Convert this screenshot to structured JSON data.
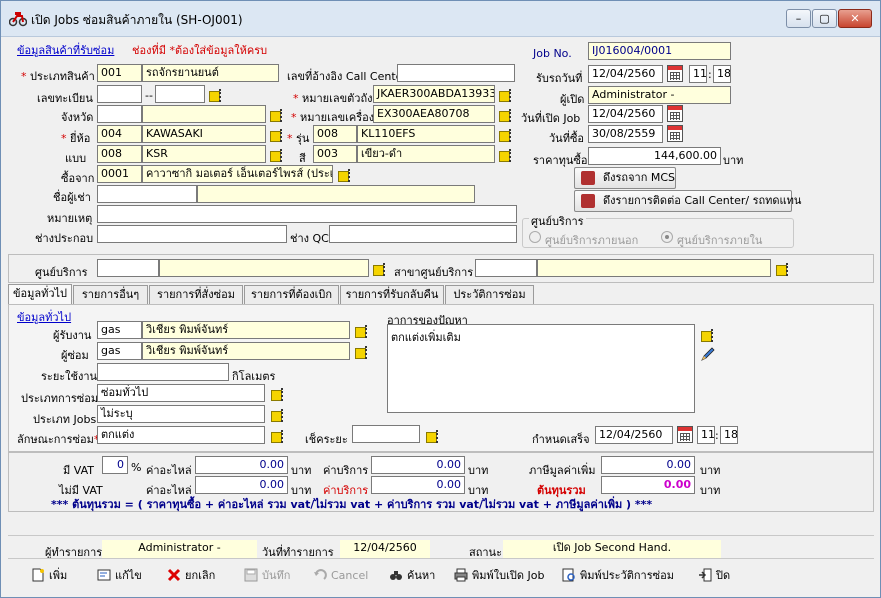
{
  "window": {
    "title": "เปิด Jobs ซ่อมสินค้าภายใน (SH-OJ001)",
    "min_label": "–",
    "max_label": "▢",
    "close_label": "✕"
  },
  "product": {
    "section_link": "ข้อมูลสินค้าที่รับซ่อม",
    "required_note": "ช่องที่มี *ต้องใส่ข้อมูลให้ครบ",
    "type_label": "ประเภทสินค้า",
    "type_code": "001",
    "type_name": "รถจักรยานยนต์",
    "regno_label": "เลขทะเบียน",
    "regno_a": "",
    "regno_sep": "--",
    "regno_b": "",
    "province_label": "จังหวัด",
    "province_code": "",
    "province_name": "",
    "brand_label": "ยี่ห้อ",
    "brand_code": "004",
    "brand_name": "KAWASAKI",
    "model_label": "แบบ",
    "model_code": "008",
    "model_name": "KSR",
    "bought_from_label": "ซื้อจาก",
    "bought_from_code": "0001",
    "bought_from_name": "คาวาซากิ มอเตอร์ เอ็นเตอร์ไพรส์ (ประเท",
    "renter_label": "ชื่อผู้เช่า",
    "renter_a": "",
    "renter_b": "",
    "note_label": "หมายเหตุ",
    "note": "",
    "assembler_label": "ช่างประกอบ",
    "assembler": "",
    "qc_label": "ช่าง QC",
    "qc": "",
    "callcenter_ref_label": "เลขที่อ้างอิง Call Center",
    "callcenter_ref": "",
    "chassis_label": "หมายเลขตัวถัง",
    "chassis": "JKAER300ABDA13933",
    "engine_label": "หมายเลขเครื่อง",
    "engine": "EX300AEA80708",
    "series_label": "รุ่น",
    "series_code": "008",
    "series_name": "KL110EFS",
    "color_label": "สี",
    "color_code": "003",
    "color_name": "เขียว-ดำ"
  },
  "job": {
    "jobno_label": "Job No.",
    "jobno": "IJ016004/0001",
    "received_label": "รับรถวันที่",
    "received_date": "12/04/2560",
    "received_hh": "11",
    "received_mm": "18",
    "opener_label": "ผู้เปิด",
    "opener": "Administrator -",
    "open_date_label": "วันที่เปิด Job",
    "open_date": "12/04/2560",
    "buy_date_label": "วันที่ซื้อ",
    "buy_date": "30/08/2559",
    "cost_label": "ราคาทุนซื้อ",
    "cost": "144,600.00",
    "cost_unit": "บาท",
    "pull_mcs_label": "ดึงรถจาก MCS",
    "pull_callcenter_label": "ดึงรายการติดต่อ Call Center/ รถทดแทน",
    "service_center_group": "ศูนย์บริการ",
    "radio_external": "ศูนย์บริการภายนอก",
    "radio_internal": "ศูนย์บริการภายใน"
  },
  "service": {
    "center_label": "ศูนย์บริการ",
    "center_code": "",
    "center_name": "",
    "branch_label": "สาขาศูนย์บริการ",
    "branch_code": "",
    "branch_name": ""
  },
  "tabs": [
    "ข้อมูลทั่วไป",
    "รายการอื่นๆ",
    "รายการที่สั่งซ่อม",
    "รายการที่ต้องเบิก",
    "รายการที่รับกลับคืน",
    "ประวัติการซ่อม"
  ],
  "general": {
    "section_link": "ข้อมูลทั่วไป",
    "receiver_label": "ผู้รับงาน",
    "receiver_code": "gas",
    "receiver_name": "วิเชียร พิมพ์จันทร์",
    "repairer_label": "ผู้ซ่อม",
    "repairer_code": "gas",
    "repairer_name": "วิเชียร พิมพ์จันทร์",
    "distance_label": "ระยะใช้งาน",
    "distance": "",
    "distance_unit": "กิโลเมตร",
    "repair_type_label": "ประเภทการซ่อม",
    "repair_type": "ซ่อมทั่วไป",
    "job_type_label": "ประเภท Jobs",
    "job_type": "ไม่ระบุ",
    "repair_nature_label": "ลักษณะการซ่อม",
    "repair_nature": "ตกแต่ง",
    "check_interval_label": "เช็คระยะ",
    "check_interval": "",
    "symptom_label": "อาการของปัญหา",
    "symptom": "ตกแต่งเพิ่มเติม",
    "due_label": "กำหนดเสร็จ",
    "due_date": "12/04/2560",
    "due_hh": "11",
    "due_mm": "18"
  },
  "costs": {
    "vat_label": "มี VAT",
    "vat_rate": "0",
    "pct": "%",
    "parts_label": "ค่าอะไหล่",
    "parts_vat": "0.00",
    "baht": "บาท",
    "service_label": "ค่าบริการ",
    "service_vat": "0.00",
    "vat_amount_label": "ภาษีมูลค่าเพิ่ม",
    "vat_amount": "0.00",
    "novat_label": "ไม่มี VAT",
    "parts_novat": "0.00",
    "service_novat": "0.00",
    "total_label": "ต้นทุนรวม",
    "total": "0.00",
    "formula": "***  ต้นทุนรวม = ( ราคาทุนซื้อ  +  ค่าอะไหล่ รวม vat/ไม่รวม vat   +  ค่าบริการ  รวม vat/ไม่รวม vat   +   ภาษีมูลค่าเพิ่ม )  ***"
  },
  "footer": {
    "doer_label": "ผู้ทำรายการ",
    "doer": "Administrator -",
    "date_label": "วันที่ทำรายการ",
    "date": "12/04/2560",
    "status_label": "สถานะ",
    "status": "เปิด  Job Second Hand."
  },
  "toolbar": {
    "add": "เพิ่ม",
    "edit": "แก้ไข",
    "cancel_doc": "ยกเลิก",
    "save": "บันทึก",
    "cancel": "Cancel",
    "search": "ค้นหา",
    "print_job": "พิมพ์ใบเปิด Job",
    "print_history": "พิมพ์ประวัติการซ่อม",
    "close": "ปิด"
  },
  "colors": {
    "accent_blue": "#00008b",
    "required_red": "#d40000",
    "field_yellow": "#ffffdd",
    "total_magenta": "#cc00cc"
  }
}
